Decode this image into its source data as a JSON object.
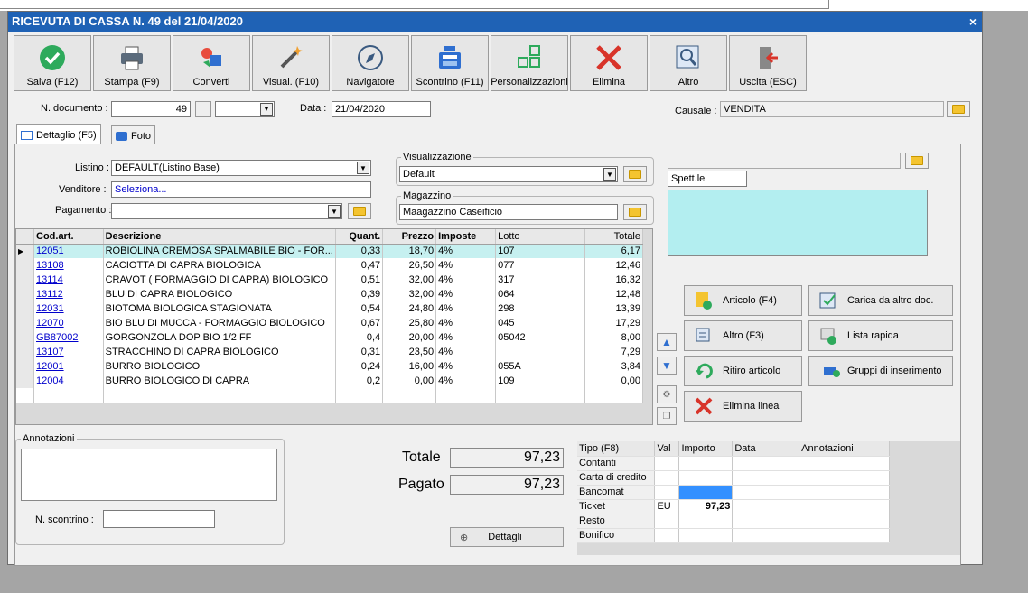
{
  "window": {
    "title": "RICEVUTA DI CASSA N. 49 del 21/04/2020",
    "close": "×"
  },
  "toolbar": [
    {
      "label": "Salva (F12)",
      "icon": "check-circle-icon"
    },
    {
      "label": "Stampa (F9)",
      "icon": "printer-icon"
    },
    {
      "label": "Converti",
      "icon": "convert-icon"
    },
    {
      "label": "Visual. (F10)",
      "icon": "magic-wand-icon"
    },
    {
      "label": "Navigatore",
      "icon": "compass-icon"
    },
    {
      "label": "Scontrino (F11)",
      "icon": "cash-register-icon"
    },
    {
      "label": "Personalizzazioni",
      "icon": "grid-squares-icon"
    },
    {
      "label": "Elimina",
      "icon": "red-x-icon"
    },
    {
      "label": "Altro",
      "icon": "magnifier-icon"
    },
    {
      "label": "Uscita (ESC)",
      "icon": "exit-door-icon"
    }
  ],
  "header": {
    "ndoc_label": "N. documento :",
    "ndoc_value": "49",
    "data_label": "Data :",
    "data_value": "21/04/2020",
    "causale_label": "Causale :",
    "causale_value": "VENDITA"
  },
  "tabs": [
    {
      "label": "Dettaglio (F5)"
    },
    {
      "label": "Foto"
    }
  ],
  "form": {
    "listino_label": "Listino :",
    "listino_value": "DEFAULT(Listino Base)",
    "venditore_label": "Venditore :",
    "venditore_value": "Seleziona...",
    "pagamento_label": "Pagamento :",
    "pagamento_value": ""
  },
  "visualizzazione": {
    "label": "Visualizzazione",
    "value": "Default"
  },
  "magazzino": {
    "label": "Magazzino",
    "value": "Maagazzino Caseificio"
  },
  "cliente": {
    "prefix": "Spett.le"
  },
  "grid": {
    "headers": [
      "Cod.art.",
      "Descrizione",
      "Quant.",
      "Prezzo",
      "Imposte",
      "Lotto",
      "Totale"
    ],
    "rows": [
      [
        "12051",
        "ROBIOLINA CREMOSA SPALMABILE BIO - FOR...",
        "0,33",
        "18,70",
        "4%",
        "107",
        "6,17"
      ],
      [
        "13108",
        "CACIOTTA DI CAPRA BIOLOGICA",
        "0,47",
        "26,50",
        "4%",
        "077",
        "12,46"
      ],
      [
        "13114",
        "CRAVOT ( FORMAGGIO DI CAPRA) BIOLOGICO",
        "0,51",
        "32,00",
        "4%",
        "317",
        "16,32"
      ],
      [
        "13112",
        "BLU DI CAPRA BIOLOGICO",
        "0,39",
        "32,00",
        "4%",
        "064",
        "12,48"
      ],
      [
        "12031",
        "BIOTOMA BIOLOGICA STAGIONATA",
        "0,54",
        "24,80",
        "4%",
        "298",
        "13,39"
      ],
      [
        "12070",
        "BIO BLU DI MUCCA - FORMAGGIO BIOLOGICO",
        "0,67",
        "25,80",
        "4%",
        "045",
        "17,29"
      ],
      [
        "GB87002",
        "GORGONZOLA DOP BIO 1/2 FF",
        "0,4",
        "20,00",
        "4%",
        "05042",
        "8,00"
      ],
      [
        "13107",
        "STRACCHINO DI CAPRA BIOLOGICO",
        "0,31",
        "23,50",
        "4%",
        "",
        "7,29"
      ],
      [
        "12001",
        "BURRO BIOLOGICO",
        "0,24",
        "16,00",
        "4%",
        "055A",
        "3,84"
      ],
      [
        "12004",
        "BURRO BIOLOGICO DI CAPRA",
        "0,2",
        "0,00",
        "4%",
        "109",
        "0,00"
      ]
    ]
  },
  "actions": {
    "articolo": "Articolo (F4)",
    "carica": "Carica da altro doc.",
    "altro": "Altro (F3)",
    "lista": "Lista rapida",
    "ritiro": "Ritiro articolo",
    "gruppi": "Gruppi di inserimento",
    "elimina": "Elimina linea"
  },
  "annotazioni": {
    "label": "Annotazioni",
    "scontrino_label": "N. scontrino :"
  },
  "totals": {
    "totale_label": "Totale",
    "totale_value": "97,23",
    "pagato_label": "Pagato",
    "pagato_value": "97,23",
    "dettagli": "Dettagli"
  },
  "payments": {
    "headers": [
      "Tipo (F8)",
      "Val",
      "Importo",
      "Data",
      "Annotazioni"
    ],
    "rows": [
      [
        "Contanti",
        "",
        "",
        "",
        ""
      ],
      [
        "Carta di credito",
        "",
        "",
        "",
        ""
      ],
      [
        "Bancomat",
        "",
        "",
        "",
        ""
      ],
      [
        "Ticket",
        "EU",
        "97,23",
        "",
        ""
      ],
      [
        "Resto",
        "",
        "",
        "",
        ""
      ],
      [
        "Bonifico",
        "",
        "",
        "",
        ""
      ]
    ]
  },
  "colors": {
    "titlebar": "#1f62b5",
    "selected_row": "#c6f0f0",
    "cyan_box": "#b3eef0",
    "bancomat_cell": "#3390ff"
  }
}
